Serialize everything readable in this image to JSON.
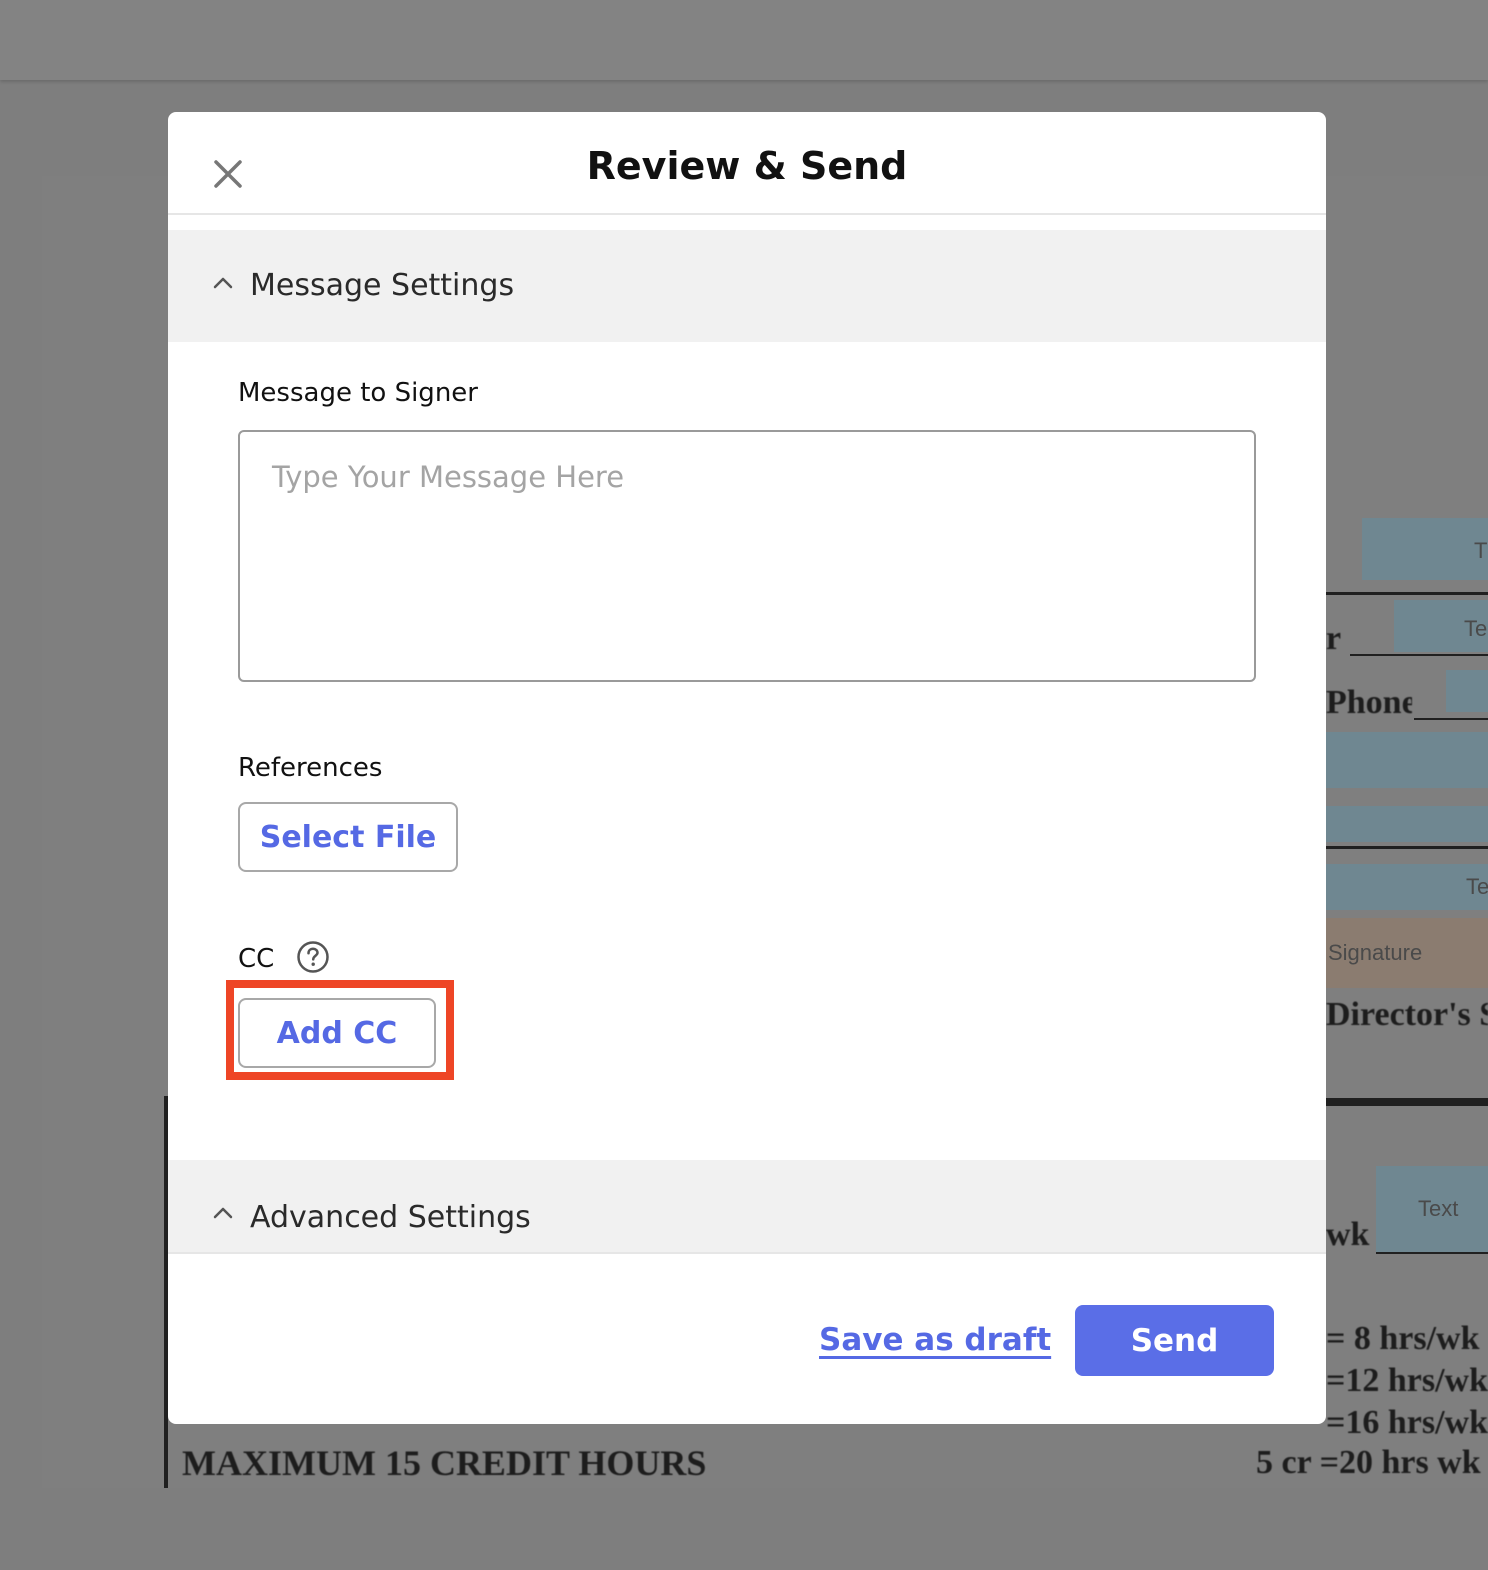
{
  "modal": {
    "title": "Review & Send"
  },
  "message_settings": {
    "header": "Message Settings",
    "message_label": "Message to Signer",
    "message_placeholder": "Type Your Message Here",
    "message_value": "",
    "references_label": "References",
    "select_file_label": "Select File",
    "cc_label": "CC",
    "add_cc_label": "Add CC"
  },
  "advanced_settings": {
    "header": "Advanced Settings"
  },
  "footer": {
    "save_draft_label": "Save as draft",
    "send_label": "Send"
  },
  "background_document": {
    "field_labels": [
      "T",
      "Te",
      "Te",
      "Signature",
      "Text"
    ],
    "text_fragments": [
      "r",
      "Phone",
      "Director's S",
      "wk",
      "= 8 hrs/wk",
      "=12 hrs/wk",
      "=16 hrs/wk",
      "5 cr =20 hrs wk",
      "MAXIMUM 15 CREDIT HOURS"
    ]
  },
  "colors": {
    "accent": "#5a6ee7",
    "highlight": "#ee4526",
    "section_bg": "#f1f1f1",
    "overlay": "#7e7e7e"
  }
}
